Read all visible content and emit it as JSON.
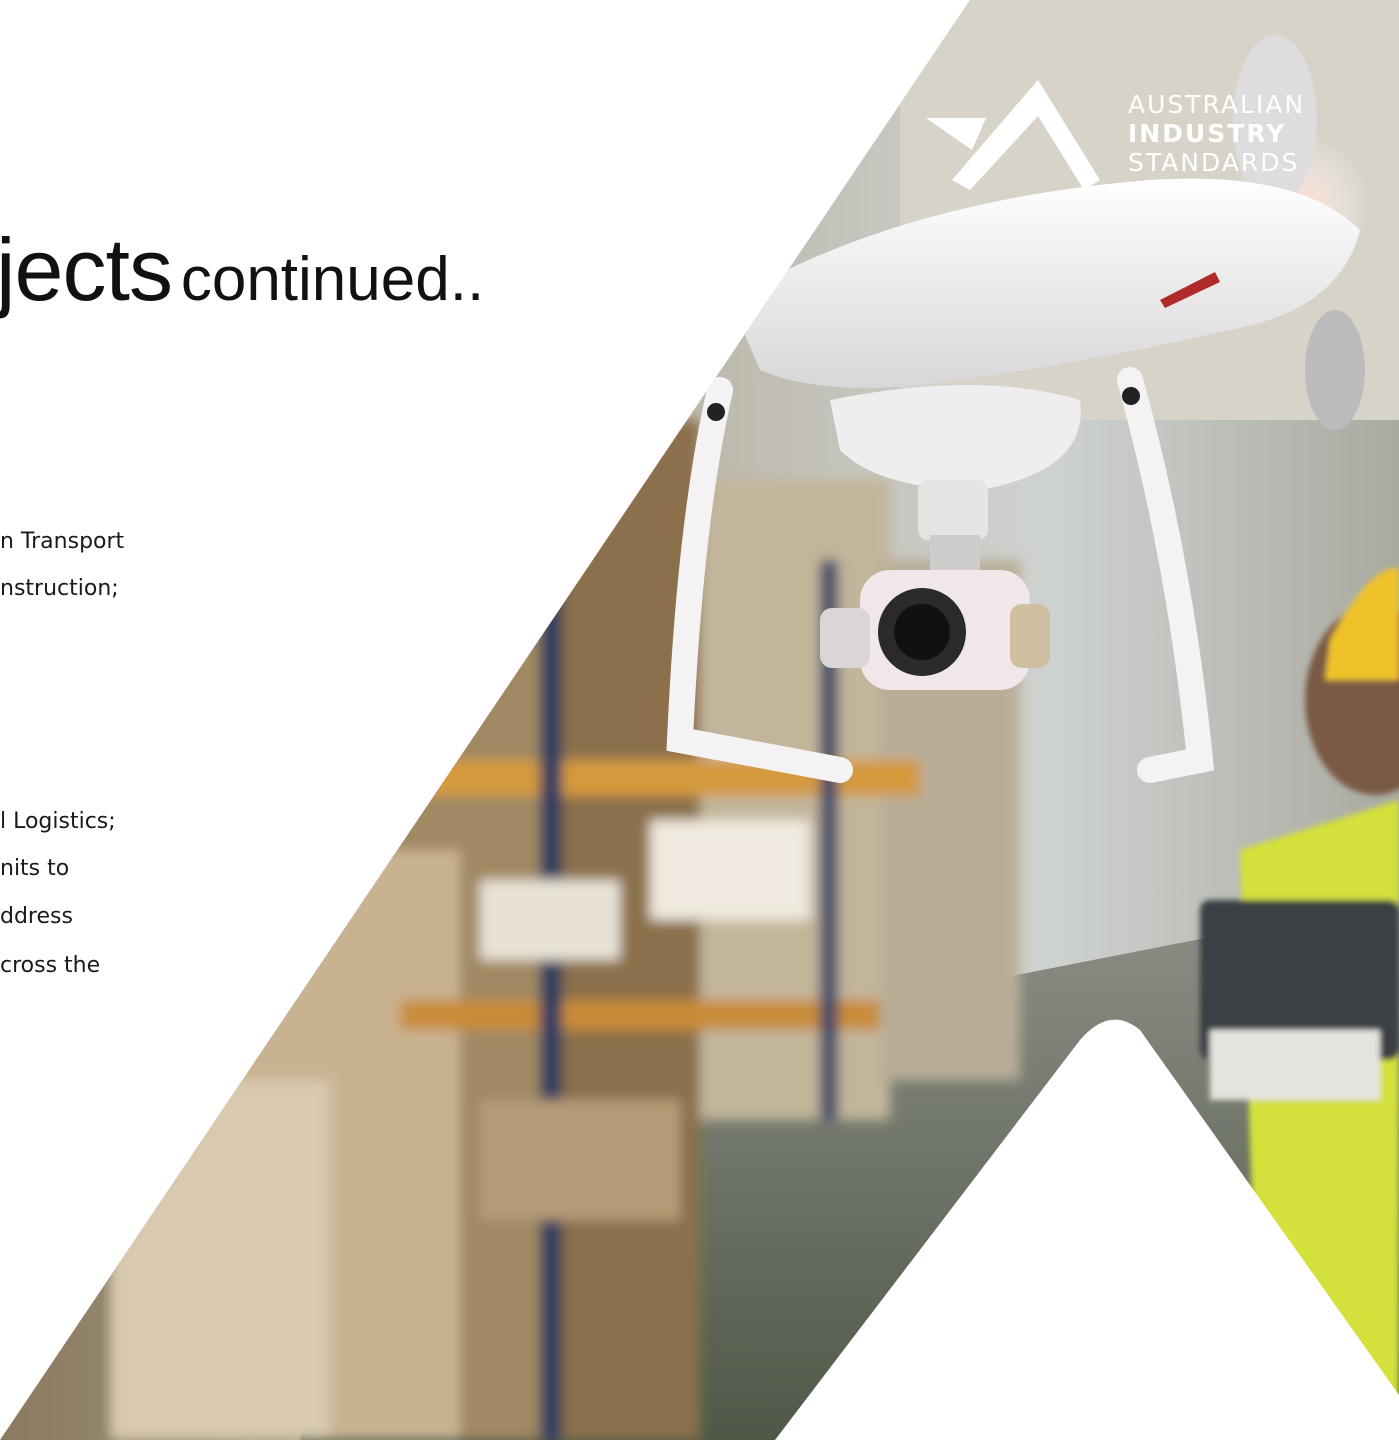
{
  "slide": {
    "title_main": "jects",
    "title_continued": "continued..",
    "body_lines": [
      "n Transport",
      "nstruction;",
      "l Logistics;",
      "nits to",
      "ddress",
      "cross the"
    ]
  },
  "logo": {
    "line1": "AUSTRALIAN",
    "line2": "INDUSTRY",
    "line3": "STANDARDS",
    "color": "#ffffff"
  },
  "photo": {
    "subject": "drone-over-warehouse-photo"
  }
}
